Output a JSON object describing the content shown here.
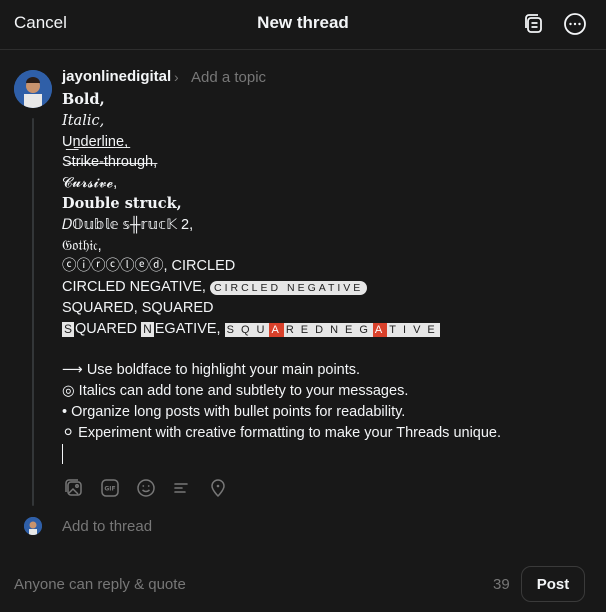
{
  "header": {
    "cancel_label": "Cancel",
    "title": "New thread",
    "drafts_icon": "drafts-icon",
    "more_icon": "more-icon"
  },
  "post": {
    "username": "jayonlinedigital",
    "topic_placeholder": "Add a topic",
    "lines": {
      "bold": "𝐁𝐨𝐥𝐝,",
      "italic": "𝐼𝑡𝑎𝑙𝑖𝑐,",
      "underline": "U͟n͟d͟e͟r͟l͟i͟n͟e͟,",
      "strike": "S̶t̶r̶i̶k̶e̶-̶t̶h̶r̶o̶u̶g̶h̶,",
      "cursive": "𝓒𝓾𝓻𝓼𝓲𝓿𝓮,",
      "double_struck": "𝐃𝐨𝐮𝐛𝐥𝐞 𝐬𝐭𝐫𝐮𝐜𝐤,",
      "weird": "𝐷𝕆𝕦𝕓𝕝𝕖 𝕤╫𝕣𝕦𝕔𝕂 2,",
      "gothic": "𝔊𝔬𝔱𝔥𝔦𝔠,",
      "circled": "ⓒⓘⓡⓒⓛⓔⓓ, CIRCLED",
      "circled_neg_prefix": "CIRCLED NEGATIVE, ",
      "circled_neg": "CIRCLED NEGATIVE",
      "squared": "SQUARED, SQUARED",
      "squared_neg_text": "QUARED",
      "squared_neg_text2": "EGATIVE,",
      "squared_neg_letters": [
        "S",
        "Q",
        "U",
        "A",
        "R",
        "E",
        "D",
        "N",
        "E",
        "G",
        "A",
        "T",
        "I",
        "V",
        "E"
      ],
      "bullet1": "⟶ Use boldface to highlight your main points.",
      "bullet2": "◎ Italics can add tone and subtlety to your messages.",
      "bullet3": "• Organize long posts with bullet points for readability.",
      "bullet4": "⚪ Experiment with creative formatting to make your Threads unique."
    },
    "toolbar_icons": [
      "image-icon",
      "gif-icon",
      "emoji-icon",
      "poll-icon",
      "location-icon"
    ]
  },
  "add_thread_label": "Add to thread",
  "footer": {
    "reply_setting": "Anyone can reply & quote",
    "char_count": "39",
    "post_label": "Post"
  }
}
